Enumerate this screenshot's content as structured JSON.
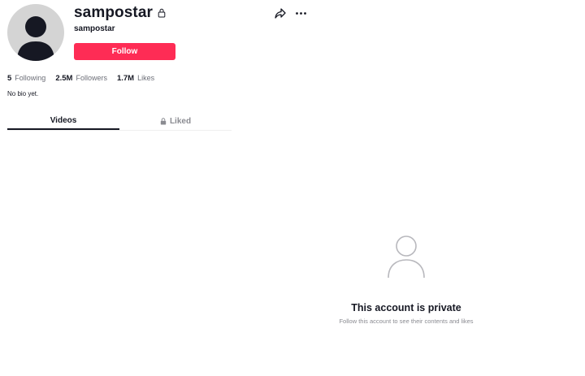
{
  "profile": {
    "display_name": "sampostar",
    "handle": "sampostar",
    "follow_label": "Follow",
    "bio": "No bio yet."
  },
  "stats": [
    {
      "value": "5",
      "label": "Following"
    },
    {
      "value": "2.5M",
      "label": "Followers"
    },
    {
      "value": "1.7M",
      "label": "Likes"
    }
  ],
  "tabs": [
    {
      "label": "Videos",
      "active": true
    },
    {
      "label": "Liked",
      "active": false,
      "icon": "lock-icon"
    }
  ],
  "private_notice": {
    "title": "This account is private",
    "subtitle": "Follow this account to see their contents and likes",
    "icon": "user-icon"
  },
  "icons": {
    "header_lock": "lock-icon",
    "share": "share-icon",
    "more": "more-icon",
    "avatar": "default-avatar-icon"
  },
  "colors": {
    "accent": "#fe2c55",
    "text": "#161823",
    "muted": "#8a8b91"
  }
}
